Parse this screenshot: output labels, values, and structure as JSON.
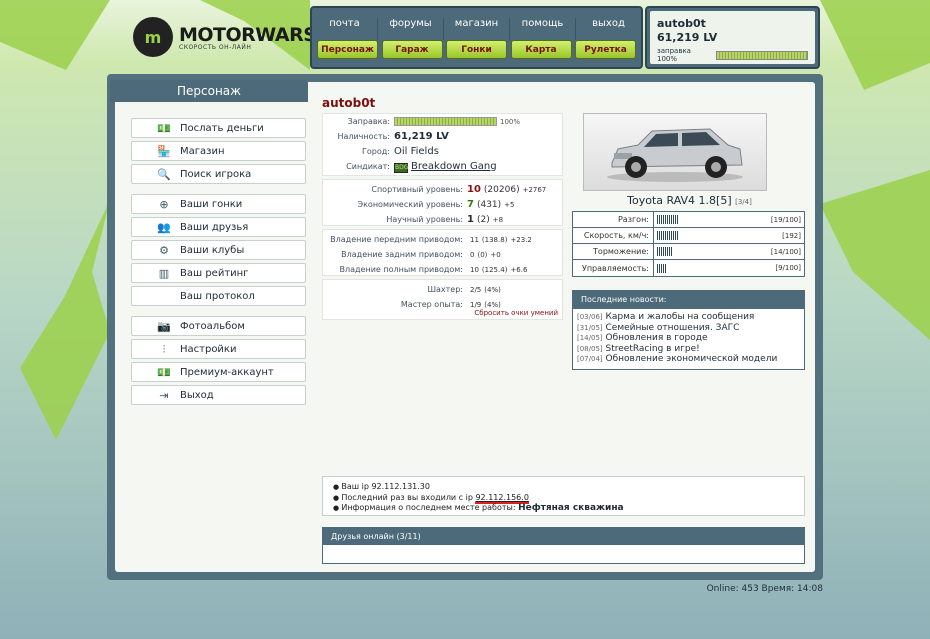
{
  "logo": {
    "name": "MOTORWARS.RU",
    "tagline": "СКОРОСТЬ ОН-ЛАЙН",
    "mark": "m"
  },
  "topnav": {
    "links": [
      "почта",
      "форумы",
      "магазин",
      "помощь",
      "выход"
    ],
    "buttons": [
      "Персонаж",
      "Гараж",
      "Гонки",
      "Карта",
      "Рулетка"
    ]
  },
  "user": {
    "name": "autob0t",
    "money": "61,219 LV",
    "fuel_label": "заправка 100%",
    "fuel_fraction": 1.0
  },
  "sidebar": {
    "title": "Персонаж",
    "groups": [
      [
        {
          "label": "Послать деньги",
          "icon": "money-icon",
          "glyph": "💵"
        },
        {
          "label": "Магазин",
          "icon": "shop-icon",
          "glyph": "🏪"
        },
        {
          "label": "Поиск игрока",
          "icon": "search-icon",
          "glyph": "🔍"
        }
      ],
      [
        {
          "label": "Ваши гонки",
          "icon": "steering-wheel-icon",
          "glyph": "⊕"
        },
        {
          "label": "Ваши друзья",
          "icon": "friends-icon",
          "glyph": "👥"
        },
        {
          "label": "Ваши клубы",
          "icon": "club-icon",
          "glyph": "⚙"
        },
        {
          "label": "Ваш рейтинг",
          "icon": "rating-icon",
          "glyph": "▥"
        },
        {
          "label": "Ваш протокол",
          "icon": "",
          "glyph": ""
        }
      ],
      [
        {
          "label": "Фотоальбом",
          "icon": "camera-icon",
          "glyph": "📷"
        },
        {
          "label": "Настройки",
          "icon": "sliders-icon",
          "glyph": "⫶"
        },
        {
          "label": "Премиум-аккаунт",
          "icon": "premium-icon",
          "glyph": "💵"
        },
        {
          "label": "Выход",
          "icon": "exit-icon",
          "glyph": "⇥"
        }
      ]
    ]
  },
  "character": {
    "name": "autob0t",
    "fuel": {
      "label": "Заправка:",
      "percent": "100%",
      "fraction": 1.0
    },
    "cash": {
      "label": "Наличность:",
      "value": "61,219 LV"
    },
    "city": {
      "label": "Город:",
      "value": "Oil Fields"
    },
    "syndicate": {
      "label": "Синдикат:",
      "value": "Breakdown Gang",
      "icon_text": "BDG"
    },
    "levels": [
      {
        "label": "Спортивный уровень:",
        "level": "10",
        "points": "(20206)",
        "delta": "+2767",
        "color": "r"
      },
      {
        "label": "Экономический уровень:",
        "level": "7",
        "points": "(431)",
        "delta": "+5",
        "color": "g"
      },
      {
        "label": "Научный уровень:",
        "level": "1",
        "points": "(2)",
        "delta": "+8",
        "color": "b"
      }
    ],
    "drive": [
      {
        "label": "Владение передним приводом:",
        "level": "11",
        "points": "(138.8)",
        "delta": "+23.2"
      },
      {
        "label": "Владение задним приводом:",
        "level": "0",
        "points": "(0)",
        "delta": "+0"
      },
      {
        "label": "Владение полным приводом:",
        "level": "10",
        "points": "(125.4)",
        "delta": "+6.6"
      }
    ],
    "other": [
      {
        "label": "Шахтер:",
        "value": "2/5",
        "pct": "(4%)"
      },
      {
        "label": "Мастер опыта:",
        "value": "1/9",
        "pct": "(4%)"
      }
    ],
    "reset_label": "Сбросить очки умений"
  },
  "car": {
    "name": "Toyota RAV4 1.8",
    "level": "[5]",
    "class": "[3/4]",
    "stats": [
      {
        "label": "Разгон:",
        "value": 19,
        "max": 100,
        "text": "[19/100]"
      },
      {
        "label": "Скорость, км/ч:",
        "value": 192,
        "max": 1000,
        "text": "[192]"
      },
      {
        "label": "Торможение:",
        "value": 14,
        "max": 100,
        "text": "[14/100]"
      },
      {
        "label": "Управляемость:",
        "value": 9,
        "max": 100,
        "text": "[9/100]"
      }
    ]
  },
  "news": {
    "title": "Последние новости:",
    "items": [
      {
        "date": "[03/06]",
        "text": "Карма и жалобы на сообщения"
      },
      {
        "date": "[31/05]",
        "text": "Семейные отношения. ЗАГС"
      },
      {
        "date": "[14/05]",
        "text": "Обновления в городе"
      },
      {
        "date": "[08/05]",
        "text": "StreetRacing в игре!"
      },
      {
        "date": "[07/04]",
        "text": "Обновление экономической модели"
      }
    ]
  },
  "ipinfo": {
    "line1": "Ваш ip 92.112.131.30",
    "line2_prefix": "Последний раз вы входили с ip ",
    "line2_ip": "92.112.156.0",
    "line3_prefix": "Информация о последнем месте работы: ",
    "line3_place": "Нефтяная скважина"
  },
  "friends": {
    "title": "Друзья онлайн (3/11)"
  },
  "footer": {
    "text": "Online: 453  Время: 14:08"
  },
  "colors": {
    "panel": "#4c6a79",
    "accent_red": "#8a1010",
    "green_btn": "#b7dc4a"
  }
}
